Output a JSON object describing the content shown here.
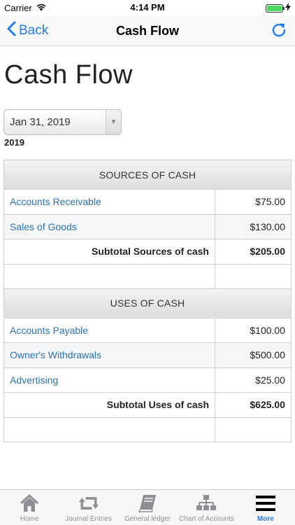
{
  "status_bar": {
    "carrier": "Carrier",
    "time": "4:14 PM",
    "battery_level": 1.0
  },
  "nav": {
    "back_label": "Back",
    "title": "Cash Flow"
  },
  "page": {
    "title": "Cash Flow",
    "date_selected": "Jan 31, 2019",
    "year": "2019"
  },
  "sources": {
    "header": "SOURCES OF CASH",
    "rows": [
      {
        "label": "Accounts Receivable",
        "amount": "$75.00"
      },
      {
        "label": "Sales of Goods",
        "amount": "$130.00"
      }
    ],
    "subtotal_label": "Subtotal Sources of cash",
    "subtotal_amount": "$205.00"
  },
  "uses": {
    "header": "USES OF CASH",
    "rows": [
      {
        "label": "Accounts Payable",
        "amount": "$100.00"
      },
      {
        "label": "Owner's Withdrawals",
        "amount": "$500.00"
      },
      {
        "label": "Advertising",
        "amount": "$25.00"
      }
    ],
    "subtotal_label": "Subtotal Uses of cash",
    "subtotal_amount": "$625.00"
  },
  "tab_bar": {
    "tabs": [
      {
        "label": "Home",
        "icon": "home-icon"
      },
      {
        "label": "Journal Entries",
        "icon": "journal-entries-icon"
      },
      {
        "label": "General ledger",
        "icon": "general-ledger-icon"
      },
      {
        "label": "Chart of Accounts",
        "icon": "chart-of-accounts-icon"
      },
      {
        "label": "More",
        "icon": "more-icon",
        "active": true
      }
    ]
  },
  "colors": {
    "accent": "#1f7cf0",
    "link": "#2a73b5",
    "battery": "#4cd964"
  }
}
